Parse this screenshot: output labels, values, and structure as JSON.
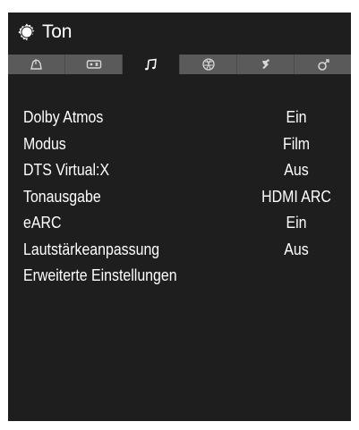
{
  "header": {
    "title": "Ton",
    "icon": "gear-icon"
  },
  "tabs": [
    {
      "icon": "picture-icon",
      "active": false
    },
    {
      "icon": "remote-icon",
      "active": false
    },
    {
      "icon": "music-note-icon",
      "active": true
    },
    {
      "icon": "network-icon",
      "active": false
    },
    {
      "icon": "satellite-icon",
      "active": false
    },
    {
      "icon": "system-icon",
      "active": false
    }
  ],
  "menu": {
    "items": [
      {
        "label": "Dolby Atmos",
        "value": "Ein"
      },
      {
        "label": "Modus",
        "value": "Film"
      },
      {
        "label": "DTS Virtual:X",
        "value": "Aus"
      },
      {
        "label": "Tonausgabe",
        "value": "HDMI ARC"
      },
      {
        "label": "eARC",
        "value": "Ein"
      },
      {
        "label": "Lautstärkeanpassung",
        "value": "Aus"
      },
      {
        "label": "Erweiterte Einstellungen",
        "value": ""
      }
    ]
  },
  "colors": {
    "panel_bg": "#1e1e1e",
    "tab_bar_bg": "#5a5a5a",
    "text": "#ffffff"
  }
}
